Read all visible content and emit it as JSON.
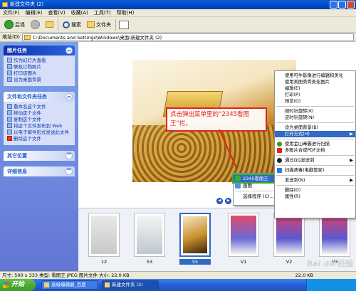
{
  "window": {
    "title": "新建文件夹 (2)"
  },
  "menu": [
    "文件(F)",
    "编辑(E)",
    "查看(V)",
    "收藏(A)",
    "工具(T)",
    "帮助(H)"
  ],
  "toolbar": {
    "back": "后退",
    "search": "搜索",
    "folders": "文件夹"
  },
  "address": {
    "label": "地址(D)",
    "path": "C:\\Documents and Settings\\Windows\\桌面\\新建文件夹 (2)"
  },
  "sidebar": {
    "panels": [
      {
        "title": "图片任务",
        "items": [
          "作为幻灯片查看",
          "联机订购照片",
          "打印该图片",
          "设为桌面背景"
        ]
      },
      {
        "title": "文件和文件夹任务",
        "items": [
          "重命名这个文件",
          "移动这个文件",
          "复制这个文件",
          "将这个文件发布到 Web",
          "以电子邮件形式发送此文件",
          "删除这个文件"
        ]
      },
      {
        "title": "其它位置",
        "items": []
      },
      {
        "title": "详细信息",
        "items": []
      }
    ]
  },
  "callout": {
    "text": "点击弹出菜单里的“2345看图王”栏。"
  },
  "context_menu": {
    "items": [
      "2345看图王",
      "画图",
      "选择程序 (C)..."
    ],
    "selected": "2345看图王"
  },
  "main_menu": {
    "items": [
      "使用可牛影像进行编辑和美化",
      "使用美图秀秀美化图片",
      "编辑(E)",
      "打印(P)",
      "预览(G)",
      "---",
      "顺时针旋转(K)",
      "逆时针旋转(N)",
      "---",
      "设为桌面背景(B)",
      "打开方式(H)",
      "---",
      "使用金山毒霸进行扫描",
      "多图片合成PDF文档",
      "---",
      "通过QQ发送到",
      "---",
      "扫描病毒(电脑管家)",
      "---",
      "发送到(N)",
      "---",
      "删除(D)",
      "属性(R)"
    ],
    "selected": "打开方式(H)"
  },
  "filmstrip": {
    "items": [
      {
        "label": "12"
      },
      {
        "label": "53"
      },
      {
        "label": "55"
      },
      {
        "label": "V1"
      },
      {
        "label": "V2"
      },
      {
        "label": "V3"
      }
    ],
    "selected": "55"
  },
  "status": {
    "left": "尺寸: 500 x 333 类型: 看图王 JPEG 图片文件 大小: 22.0 KB",
    "right": "22.0 KB"
  },
  "taskbar": {
    "start": "开始",
    "tasks": [
      "高级编辑器_百度",
      "新建文件夹 (2)"
    ],
    "active": "新建文件夹 (2)"
  },
  "watermark": "Bai du 经验"
}
